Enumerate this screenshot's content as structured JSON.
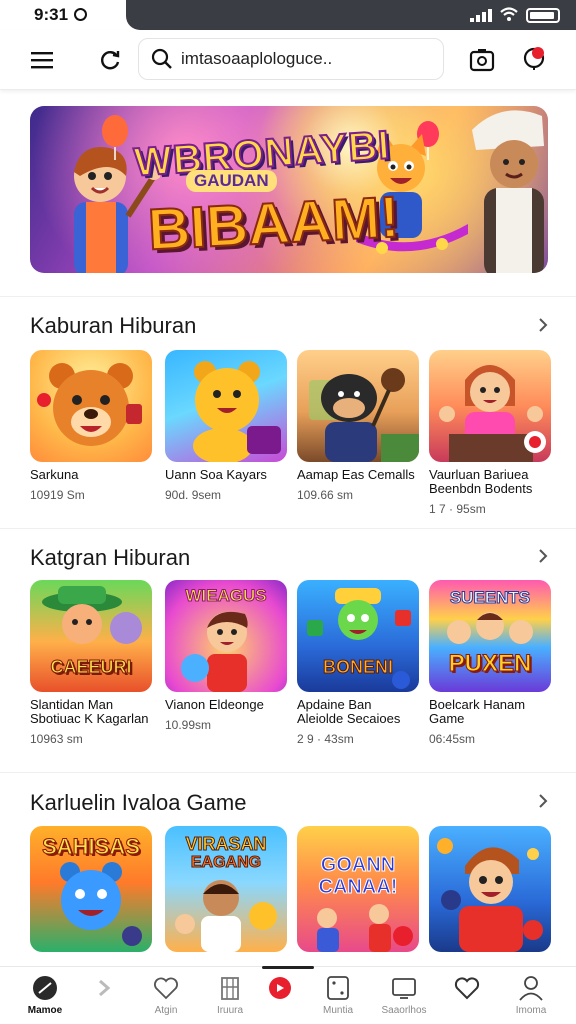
{
  "status": {
    "time": "9:31"
  },
  "search": {
    "placeholder": "imtasoaaplologuce.."
  },
  "banner": {
    "line1": "WBRONAYBI",
    "line2": "GAUDAN",
    "line3": "BIBAAM!"
  },
  "sections": [
    {
      "title": "Kaburan Hiburan",
      "items": [
        {
          "name": "Sarkuna",
          "size": "10919 Sm"
        },
        {
          "name": "Uann Soa Kayars",
          "size": "90d. 9sem"
        },
        {
          "name": "Aamap Eas Cemalls",
          "size": "109.66 sm"
        },
        {
          "name": "Vaurluan Bariuea Beenbdn Bodents",
          "size": "1 7 · 95sm"
        }
      ]
    },
    {
      "title": "Katgran Hiburan",
      "items": [
        {
          "name": "Slantidan Man Sbotiuac K Kagarlan",
          "size": "10963 sm",
          "label": "CAEEURI"
        },
        {
          "name": "Vianon Eldeonge",
          "size": "10.99sm",
          "label": "WIEAGUS"
        },
        {
          "name": "Apdaine Ban Aleiolde Secaioes",
          "size": "2 9 · 43sm",
          "label": "BONENI"
        },
        {
          "name": "Boelcark Hanam Game",
          "size": "06:45sm",
          "label": "PUXEN",
          "label2": "SUEENTS"
        }
      ]
    },
    {
      "title": "Karluelin Ivaloa Game",
      "items": [
        {
          "label": "SAHISAS"
        },
        {
          "label": "VIRASAN",
          "label2": "EAGANG"
        },
        {
          "label": "GOANN CANAA!"
        },
        {
          "label": ""
        }
      ]
    }
  ],
  "nav": [
    {
      "label": "Mamoe",
      "icon": "home-icon"
    },
    {
      "label": "",
      "icon": "arrow-icon"
    },
    {
      "label": "Atgin",
      "icon": "heart-icon"
    },
    {
      "label": "Iruura",
      "icon": "building-icon"
    },
    {
      "label": "",
      "icon": "record-icon"
    },
    {
      "label": "Muntia",
      "icon": "dice-icon"
    },
    {
      "label": "Saaorlhos",
      "icon": "tablet-icon"
    },
    {
      "label": "",
      "icon": "heart-outline-icon"
    },
    {
      "label": "Imoma",
      "icon": "profile-icon"
    }
  ],
  "colors": {
    "accent": "#e8202e",
    "section_text": "#1a1a1a",
    "meta_text": "#555555"
  }
}
